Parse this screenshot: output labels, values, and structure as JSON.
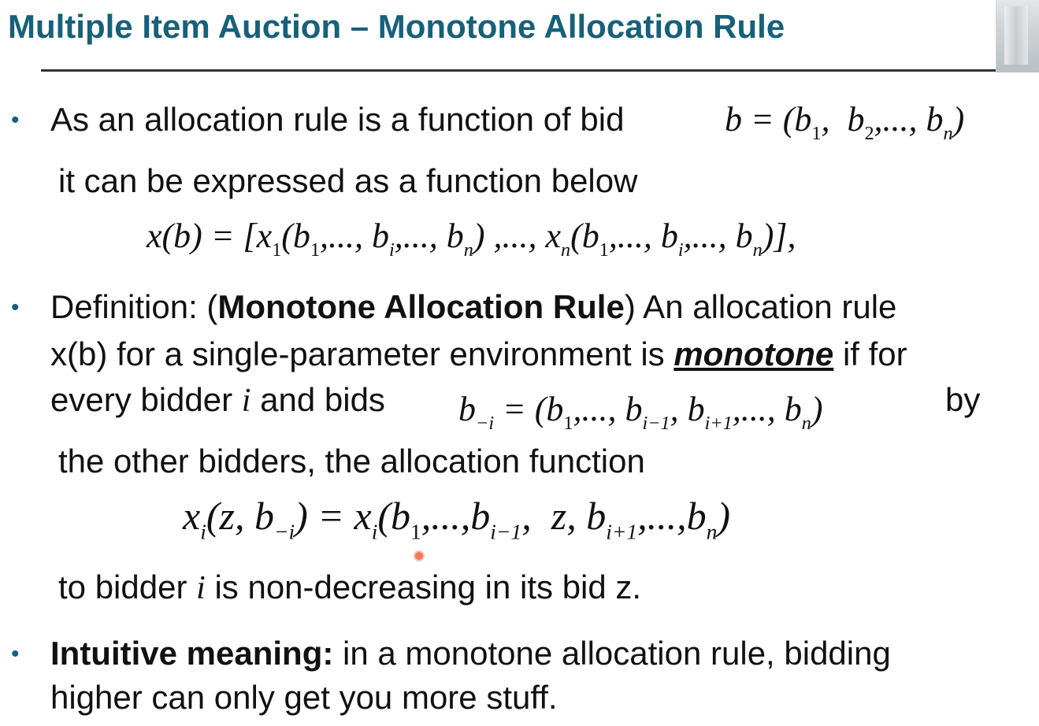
{
  "title": "Multiple Item Auction – Monotone Allocation Rule",
  "bullets": {
    "b1": {
      "text": "As an allocation rule is a function of bid",
      "math_bid": "b = (b1, b2,..., bn)",
      "line2": "it can be expressed as a function below",
      "math_x": "x(b) = [x1(b1,..., bi,..., bn) ,..., xn(b1,..., bi,..., bn)],"
    },
    "b2": {
      "prefix": "Definition: (",
      "bold": "Monotone Allocation Rule",
      "suffix": ") An allocation rule",
      "line2_a": "x(b) for a single-parameter environment is ",
      "line2_em": "monotone",
      "line2_b": " if for",
      "line3_a": "every bidder ",
      "line3_i": "i",
      "line3_b": " and bids",
      "math_bmi": "b−i = (b1,..., bi−1, bi+1,..., bn)",
      "line3_by": "by",
      "line4": "the other bidders, the allocation function",
      "math_xi": "xi(z, b−i) = xi(b1,...,bi−1, z, bi+1,...,bn)",
      "line5_a": "to bidder ",
      "line5_i": "i",
      "line5_b": " is non-decreasing in its bid z."
    },
    "b3": {
      "bold": "Intuitive meaning:",
      "text": " in a monotone allocation rule, bidding",
      "line2": "higher can only get you more stuff."
    }
  },
  "bullet_char": "•"
}
